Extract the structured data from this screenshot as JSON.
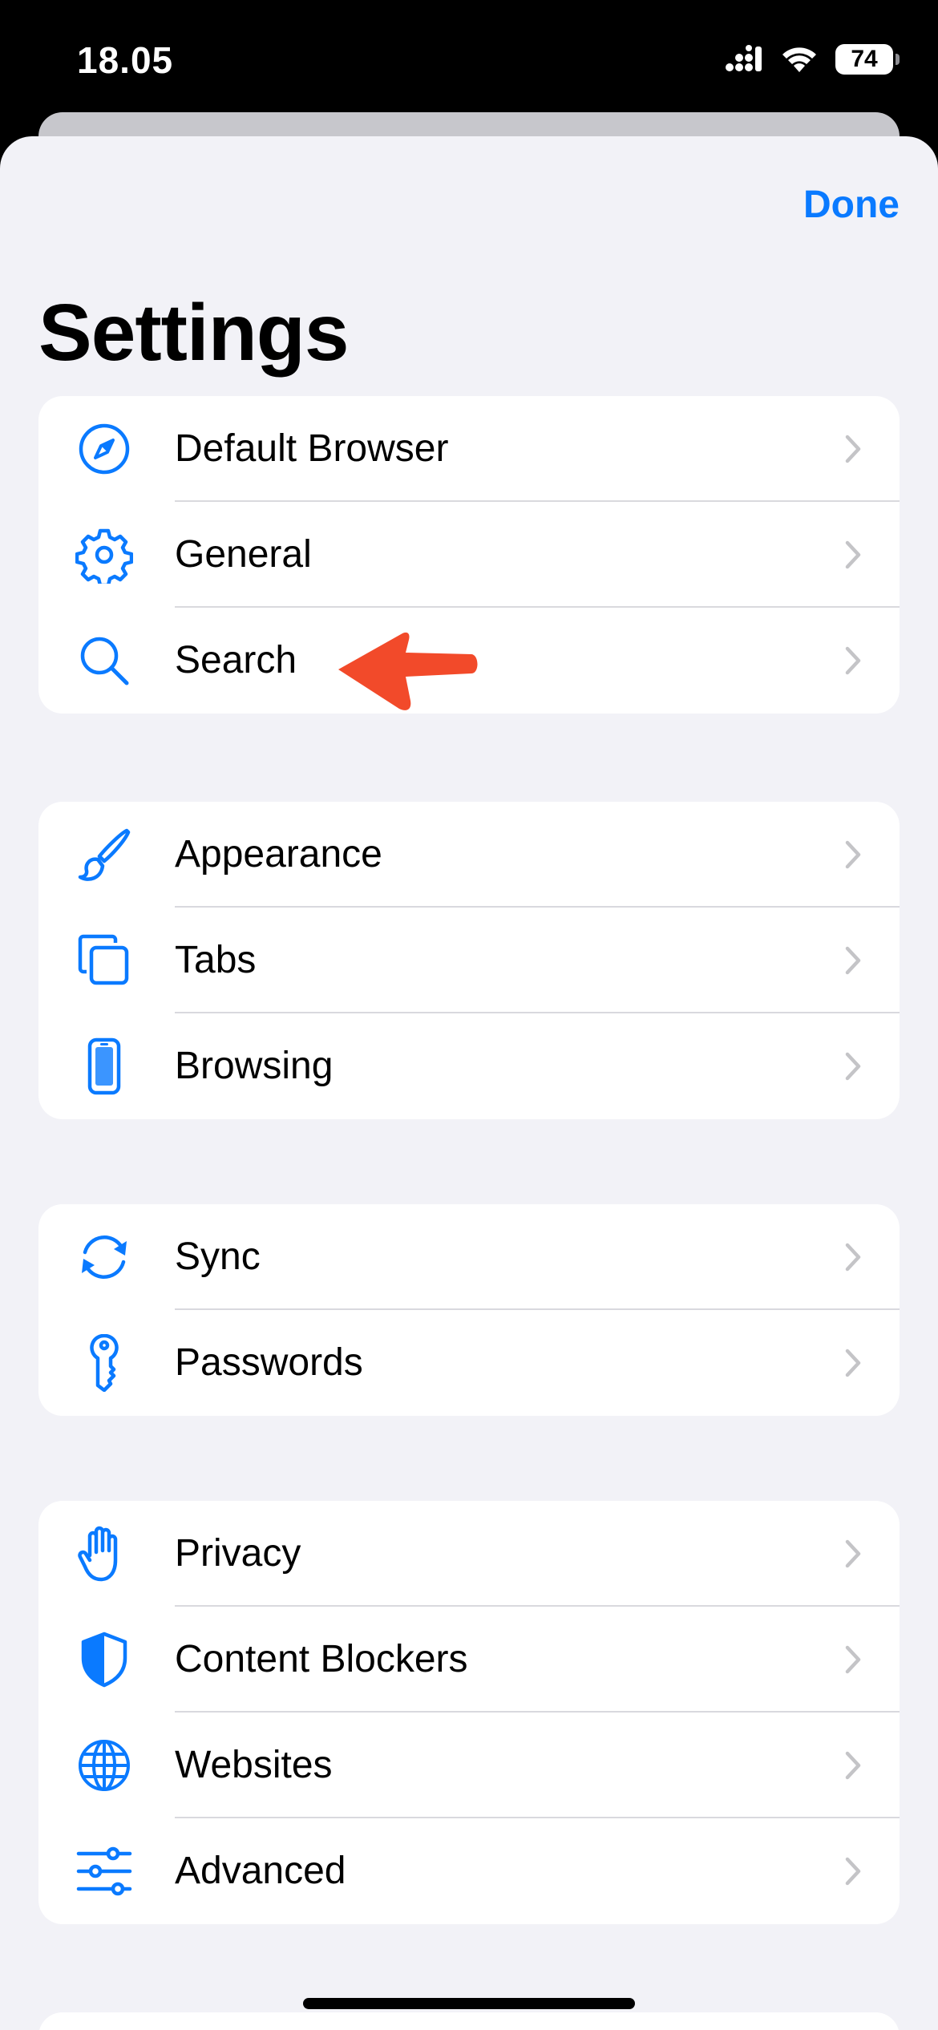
{
  "status_bar": {
    "time": "18.05",
    "battery": "74"
  },
  "header": {
    "done_label": "Done",
    "title": "Settings"
  },
  "groups": [
    {
      "items": [
        {
          "label": "Default Browser",
          "icon": "compass-icon"
        },
        {
          "label": "General",
          "icon": "gear-icon"
        },
        {
          "label": "Search",
          "icon": "search-icon"
        }
      ]
    },
    {
      "items": [
        {
          "label": "Appearance",
          "icon": "paintbrush-icon"
        },
        {
          "label": "Tabs",
          "icon": "tabs-icon"
        },
        {
          "label": "Browsing",
          "icon": "phone-icon"
        }
      ]
    },
    {
      "items": [
        {
          "label": "Sync",
          "icon": "sync-icon"
        },
        {
          "label": "Passwords",
          "icon": "key-icon"
        }
      ]
    },
    {
      "items": [
        {
          "label": "Privacy",
          "icon": "hand-icon"
        },
        {
          "label": "Content Blockers",
          "icon": "shield-icon"
        },
        {
          "label": "Websites",
          "icon": "globe-icon"
        },
        {
          "label": "Advanced",
          "icon": "sliders-icon"
        }
      ]
    }
  ],
  "colors": {
    "accent": "#0a7aff",
    "annotation_arrow": "#f24a2a",
    "background": "#f2f2f7"
  }
}
